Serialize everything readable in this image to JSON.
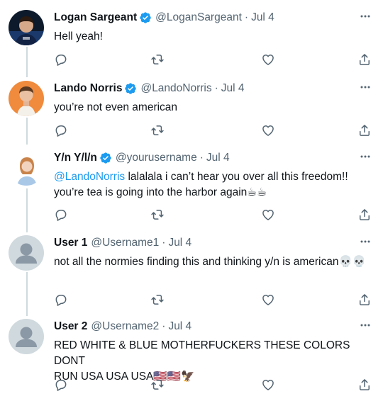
{
  "tweets": [
    {
      "name": "Logan Sargeant",
      "handle": "@LoganSargeant",
      "date": "Jul 4",
      "verified": true,
      "text": "Hell yeah!",
      "avatar": "logan-avatar"
    },
    {
      "name": "Lando Norris",
      "handle": "@LandoNorris",
      "date": "Jul 4",
      "verified": true,
      "text": "you’re not even american",
      "avatar": "lando-avatar"
    },
    {
      "name": "Y/n Y/l/n",
      "handle": "@yourusername",
      "date": "Jul 4",
      "verified": true,
      "mention": "@LandoNorris",
      "text": " lalalala i can’t hear you over all this freedom!!",
      "text2": "you’re tea is going into the harbor again☕☕",
      "avatar": "yn-avatar"
    },
    {
      "name": "User 1",
      "handle": "@Username1",
      "date": "Jul 4",
      "verified": false,
      "text": "not all the normies finding this and thinking y/n is american💀💀",
      "avatar": "default-avatar"
    },
    {
      "name": "User 2",
      "handle": "@Username2",
      "date": "Jul 4",
      "verified": false,
      "text": "RED WHITE & BLUE MOTHERFUCKERS THESE COLORS DONT",
      "text2": "RUN USA USA USA🇺🇸🇺🇸🦅",
      "avatar": "default-avatar"
    }
  ],
  "separator": "·",
  "icons": {
    "reply": "reply-icon",
    "retweet": "retweet-icon",
    "like": "like-icon",
    "share": "share-icon",
    "more": "more-icon",
    "verified": "verified-badge-icon"
  },
  "colors": {
    "accent": "#1d9bf0",
    "secondary_text": "#536471",
    "thread_line": "#cfd9de"
  }
}
